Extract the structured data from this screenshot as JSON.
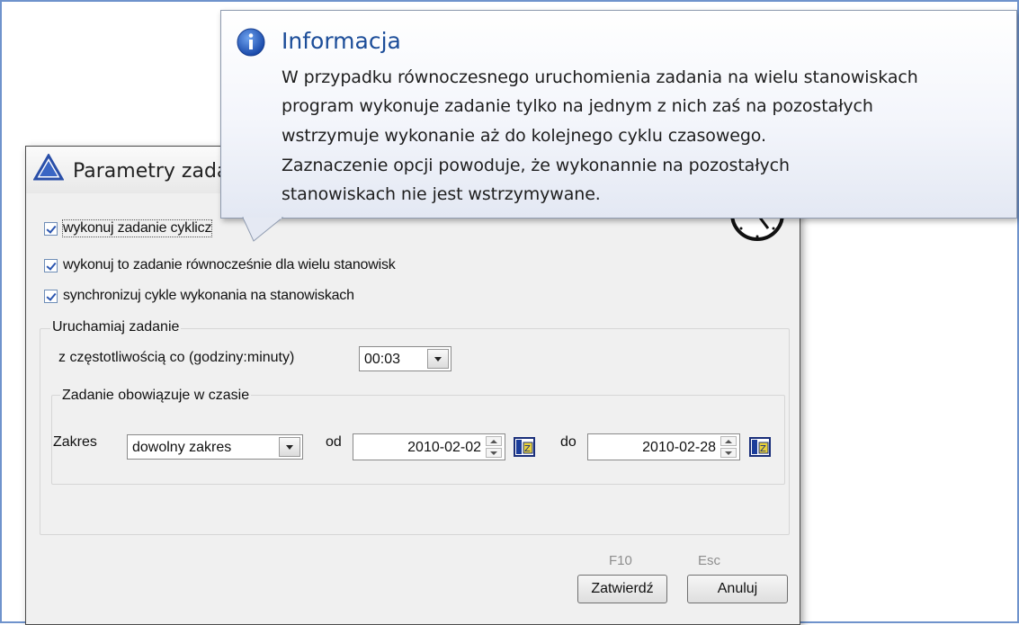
{
  "dialog": {
    "title": "Parametry zada",
    "checkboxes": [
      {
        "label": "wykonuj zadanie cyklicz",
        "checked": true
      },
      {
        "label": "wykonuj to zadanie równocześnie dla wielu stanowisk",
        "checked": true
      },
      {
        "label": "synchronizuj cykle wykonania na stanowiskach",
        "checked": true
      }
    ],
    "run_group": {
      "label": "Uruchamiaj zadanie",
      "frequency_label": "z częstotliwością co  (godziny:minuty)",
      "frequency_value": "00:03"
    },
    "validity_group": {
      "label": "Zadanie obowiązuje w czasie",
      "range_label": "Zakres",
      "range_value": "dowolny zakres",
      "from_label": "od",
      "from_value": "2010-02-02",
      "to_label": "do",
      "to_value": "2010-02-28"
    },
    "buttons": {
      "confirm_shortcut": "F10",
      "confirm_label": "Zatwierdź",
      "cancel_shortcut": "Esc",
      "cancel_label": "Anuluj"
    }
  },
  "tooltip": {
    "title": "Informacja",
    "lines": [
      "W przypadku równoczesnego uruchomienia zadania na wielu stanowiskach",
      "program wykonuje zadanie tylko na jednym z nich zaś na pozostałych",
      "wstrzymuje wykonanie aż do kolejnego cyklu czasowego.",
      "Zaznaczenie opcji powoduje, że wykonannie na pozostałych",
      "stanowiskach nie jest wstrzymywane."
    ]
  },
  "icons": {
    "title": "warning-triangle-icon",
    "clock": "clock-icon",
    "info": "info-icon",
    "calendar": "calendar-icon"
  },
  "colors": {
    "tooltip_title": "#1c4d99",
    "frame_border": "#6f93cc",
    "dialog_bg": "#f0f0f0"
  }
}
